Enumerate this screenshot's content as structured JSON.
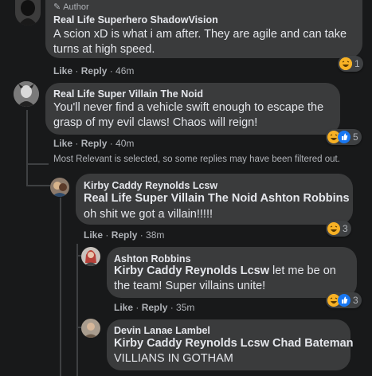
{
  "top_comment": {
    "badge": "Author",
    "author": "Real Life Superhero ShadowVision",
    "text": "A scion xD is what i am after. They are agile and can take turns at high speed.",
    "like": "Like",
    "reply": "Reply",
    "time": "46m",
    "reaction_count": "1"
  },
  "villain_comment": {
    "author": "Real Life Super Villain The Noid",
    "text": "You'll never find a vehicle swift enough to escape the grasp of my evil claws! Chaos will reign!",
    "like": "Like",
    "reply": "Reply",
    "time": "40m",
    "reaction_count": "5"
  },
  "filter_notice": "Most Relevant is selected, so some replies may have been filtered out.",
  "replies": [
    {
      "author": "Kirby Caddy Reynolds Lcsw",
      "mention": "Real Life Super Villain The Noid Ashton Robbins",
      "text": "oh shit we got a villain!!!!!",
      "like": "Like",
      "reply": "Reply",
      "time": "38m",
      "reaction_count": "3"
    },
    {
      "author": "Ashton Robbins",
      "mention": "Kirby Caddy Reynolds Lcsw",
      "text": " let me be on the team! Super villains unite!",
      "like": "Like",
      "reply": "Reply",
      "time": "35m",
      "reaction_count": "3"
    },
    {
      "author": "Devin Lanae Lambel",
      "mention": "Kirby Caddy Reynolds Lcsw Chad Bateman",
      "text": "VILLIANS IN GOTHAM"
    }
  ],
  "separator": " · ",
  "colors": {
    "background": "#18191a",
    "bubble": "#3a3b3c",
    "text": "#e4e6eb",
    "secondary_text": "#b0b3b8",
    "haha_yellow": "#f7b125",
    "like_blue": "#1877f2"
  }
}
